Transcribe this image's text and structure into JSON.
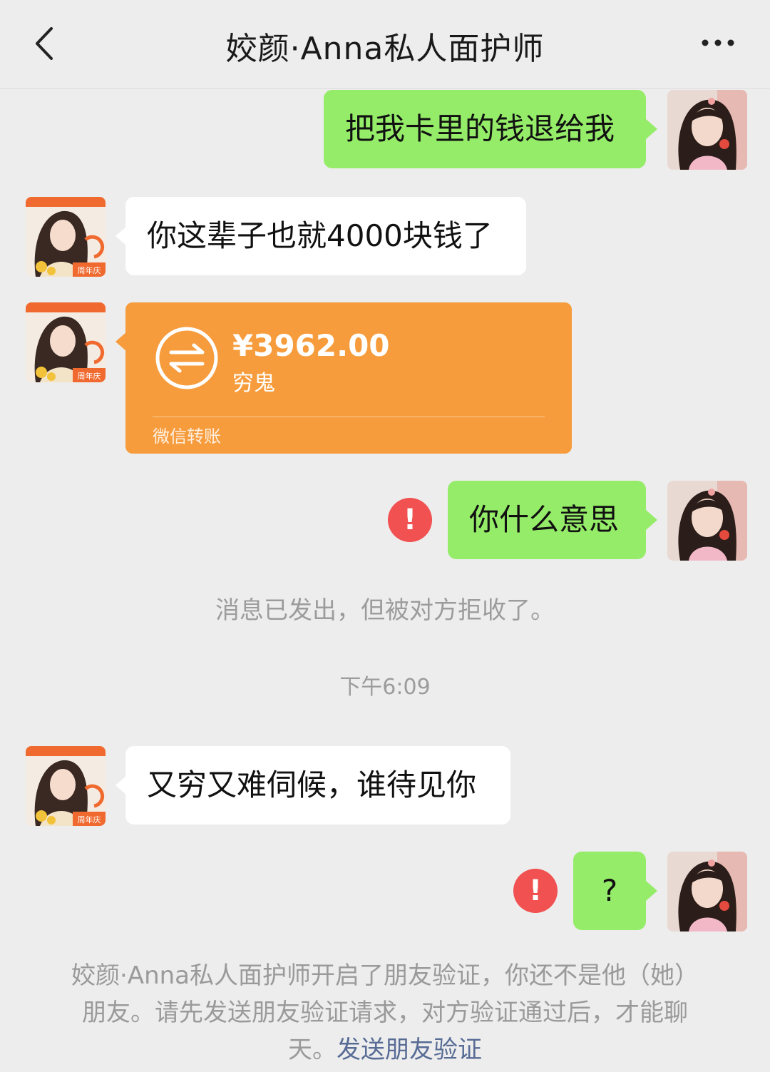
{
  "header": {
    "title": "姣颜·Anna私人面护师"
  },
  "messages": {
    "m1": "把我卡里的钱退给我",
    "m2": "你这辈子也就4000块钱了",
    "m3": "你什么意思",
    "m4": "又穷又难伺候，谁待见你",
    "m5": "?"
  },
  "transfer": {
    "amount": "¥3962.00",
    "note": "穷鬼",
    "label": "微信转账"
  },
  "system": {
    "rejected": "消息已发出，但被对方拒收了。",
    "time": "下午6:09",
    "verify_text": "姣颜·Anna私人面护师开启了朋友验证，你还不是他（她）朋友。请先发送朋友验证请求，对方验证通过后，才能聊天。",
    "verify_link": "发送朋友验证"
  },
  "avatar_other_badge": "周年庆",
  "colors": {
    "my_bubble": "#95ec69",
    "transfer": "#f79c3c",
    "error": "#f15151",
    "link": "#576b95"
  }
}
